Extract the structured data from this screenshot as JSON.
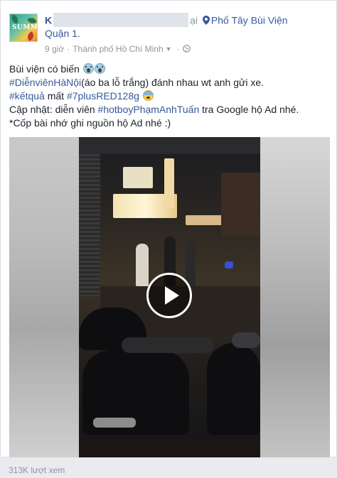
{
  "post": {
    "author": {
      "name_visible_initial": "K",
      "name_tail": "ại",
      "location": "Phố Tây Bùi Viện",
      "location_line2": "Quận 1."
    },
    "meta": {
      "time": "9 giờ",
      "separator": "·",
      "city": "Thành phố Hồ Chí Minh",
      "dropdown_glyph": "▼",
      "privacy_icon": "globe-icon"
    },
    "text": {
      "line1": "Bùi viện có biến",
      "line2_hashtag": "#DiễnviênHàNội",
      "line2_rest": "(áo ba lỗ trắng) đánh nhau wt anh gửi xe.",
      "line3_hashtag1": "#kếtquả",
      "line3_mid": " mất ",
      "line3_hashtag2": "#7plusRED128g",
      "line4_start": "Cập nhật: diễn viên ",
      "line4_hashtag": "#hotboyPhạmAnhTuấn",
      "line4_end": " tra Google hộ Ad nhé.",
      "line5": "*Cốp bài nhớ ghi nguồn hộ Ad nhé :)"
    },
    "avatar": {
      "caption": "SUMMER"
    },
    "video": {
      "play_icon": "play-icon"
    },
    "views": "313K lượt xem"
  },
  "colors": {
    "link": "#365899",
    "meta": "#90949c",
    "text": "#1d2129",
    "background": "#e9ebee",
    "card": "#ffffff"
  }
}
